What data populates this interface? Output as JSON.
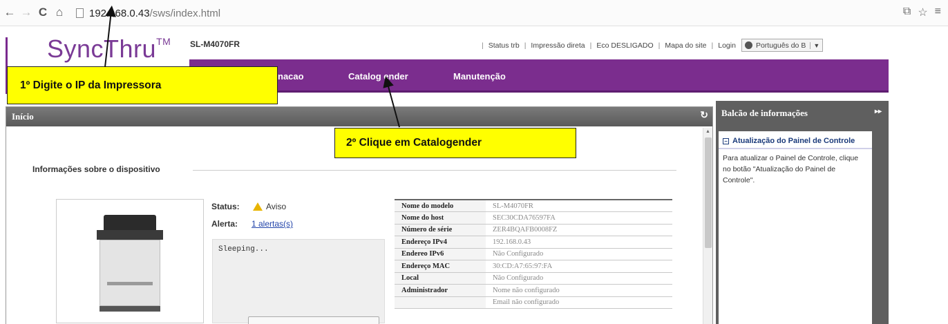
{
  "browser": {
    "url_host": "192.168.0.43",
    "url_path": "/sws/index.html"
  },
  "header": {
    "logo": "SyncThru",
    "logo_tm": "TM",
    "model": "SL-M4070FR",
    "links": [
      "Status trb",
      "Impressão direta",
      "Eco DESLIGADO",
      "Mapa do site",
      "Login"
    ],
    "language": "Português do B"
  },
  "nav": {
    "items": [
      {
        "label": "nacao"
      },
      {
        "label": "Catalog ender"
      },
      {
        "label": "Manutenção"
      }
    ]
  },
  "panel": {
    "title": "Início",
    "section_title": "Informações sobre o dispositivo"
  },
  "device": {
    "status_label": "Status:",
    "status_value": "Aviso",
    "alert_label": "Alerta:",
    "alert_value": "1 alertas(s)",
    "message": "Sleeping..."
  },
  "info_table": [
    {
      "key": "Nome do modelo",
      "value": "SL-M4070FR"
    },
    {
      "key": "Nome do host",
      "value": "SEC30CDA76597FA"
    },
    {
      "key": "Número de série",
      "value": "ZER4BQAFB0008FZ"
    },
    {
      "key": "Endereço IPv4",
      "value": "192.168.0.43"
    },
    {
      "key": "Endereo IPv6",
      "value": "Não Configurado"
    },
    {
      "key": "Endereço MAC",
      "value": "30:CD:A7:65:97:FA"
    },
    {
      "key": "Local",
      "value": "Não Configurado"
    },
    {
      "key": "Administrador",
      "value": "Nome não configurado"
    },
    {
      "key": "",
      "value": "Email não configurado"
    }
  ],
  "info_panel": {
    "title": "Balcão de informações",
    "item_title": "Atualização do Painel de Controle",
    "item_text": "Para atualizar o Painel de Controle, clique no botão \"Atualização do Painel de Controle\"."
  },
  "annotations": {
    "step1": "1º Digite o IP da Impressora",
    "step2": "2º Clique em Catalogender"
  },
  "colors": {
    "brand": "#7b2d8e",
    "callout": "#ffff00"
  }
}
